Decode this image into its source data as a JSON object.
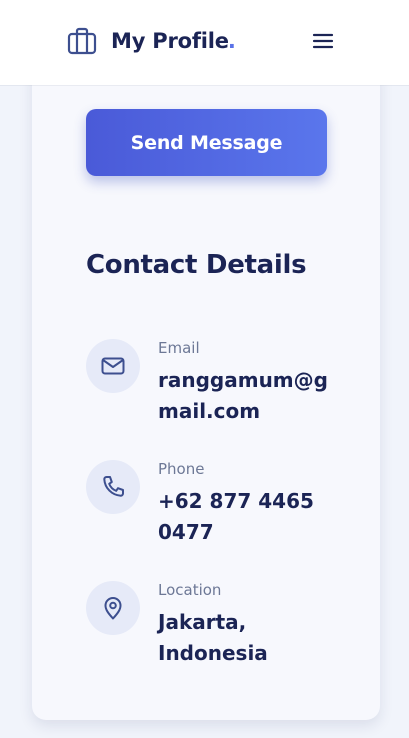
{
  "header": {
    "title": "My Profile",
    "title_dot": ".",
    "logo_icon": "briefcase-icon",
    "menu_icon": "hamburger-menu-icon"
  },
  "actions": {
    "send_message_label": "Send Message"
  },
  "contact": {
    "title": "Contact Details",
    "items": [
      {
        "label": "Email",
        "value_line1": "ranggamum@g",
        "value_line2": "mail.com",
        "icon": "mail-icon"
      },
      {
        "label": "Phone",
        "value_line1": "+62 877 4465",
        "value_line2": "0477",
        "icon": "phone-icon"
      },
      {
        "label": "Location",
        "value_line1": "Jakarta,",
        "value_line2": "Indonesia",
        "icon": "map-pin-icon"
      }
    ]
  },
  "colors": {
    "accent": "#5a72e8",
    "text_dark": "#1b2455",
    "text_muted": "#6d7896",
    "icon_bg": "#e6eaf8",
    "page_bg": "#f1f4fb"
  }
}
